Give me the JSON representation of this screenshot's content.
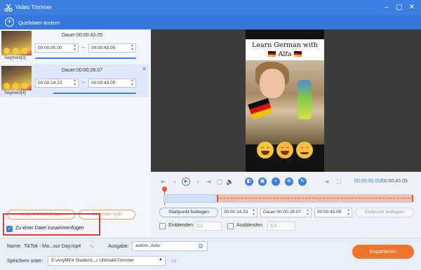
{
  "window": {
    "title": "Video Trimmer"
  },
  "toolbar": {
    "add_source": "Quelldatei ändern"
  },
  "segments": [
    {
      "label": "Segment[3]",
      "duration": "Dauer:00:00:43.05",
      "start": "00:00:00.00",
      "end": "00:00:43.05"
    },
    {
      "label": "Segment[4]",
      "duration": "Dauer:00:00:28.07",
      "start": "00:00:14.23",
      "end": "00:00:43.05"
    }
  ],
  "left_actions": {
    "add_segment": "Segment hinzufügen",
    "fast_split": "Schneller Split",
    "merge_label": "Zu einer Datei zusammenfügen",
    "merge_checked": true
  },
  "video": {
    "caption_line1": "Learn German with",
    "caption_line2": "🇩🇪 Alfa 🇩🇪"
  },
  "playback": {
    "current_time": "00:00:00.00",
    "total_time": "/00:00:43.05"
  },
  "trim": {
    "set_start": "Startpunkt festlegen",
    "start_value": "00:00:14.23",
    "duration": "Dauer:00:00:28.07",
    "end_value": "00:00:43.05",
    "set_end": "Endpunkt festlegen"
  },
  "fade": {
    "fade_in": "Einblenden",
    "fade_in_value": "3,0",
    "fade_out": "Ausblenden",
    "fade_out_value": "3,0"
  },
  "bottom": {
    "name_label": "Name:",
    "name_value": "TikTok - Ma...our Day.mp4",
    "output_label": "Ausgabe:",
    "output_value": "autom.;Auto",
    "save_label": "Speichern unter:",
    "save_path": "E:\\AnyMP4 Studio\\A...r Ultimate\\Trimmer",
    "export": "Exportieren"
  },
  "colors": {
    "accent": "#3d7fe0",
    "export": "#f0742a",
    "highlight_box": "#e53935"
  }
}
